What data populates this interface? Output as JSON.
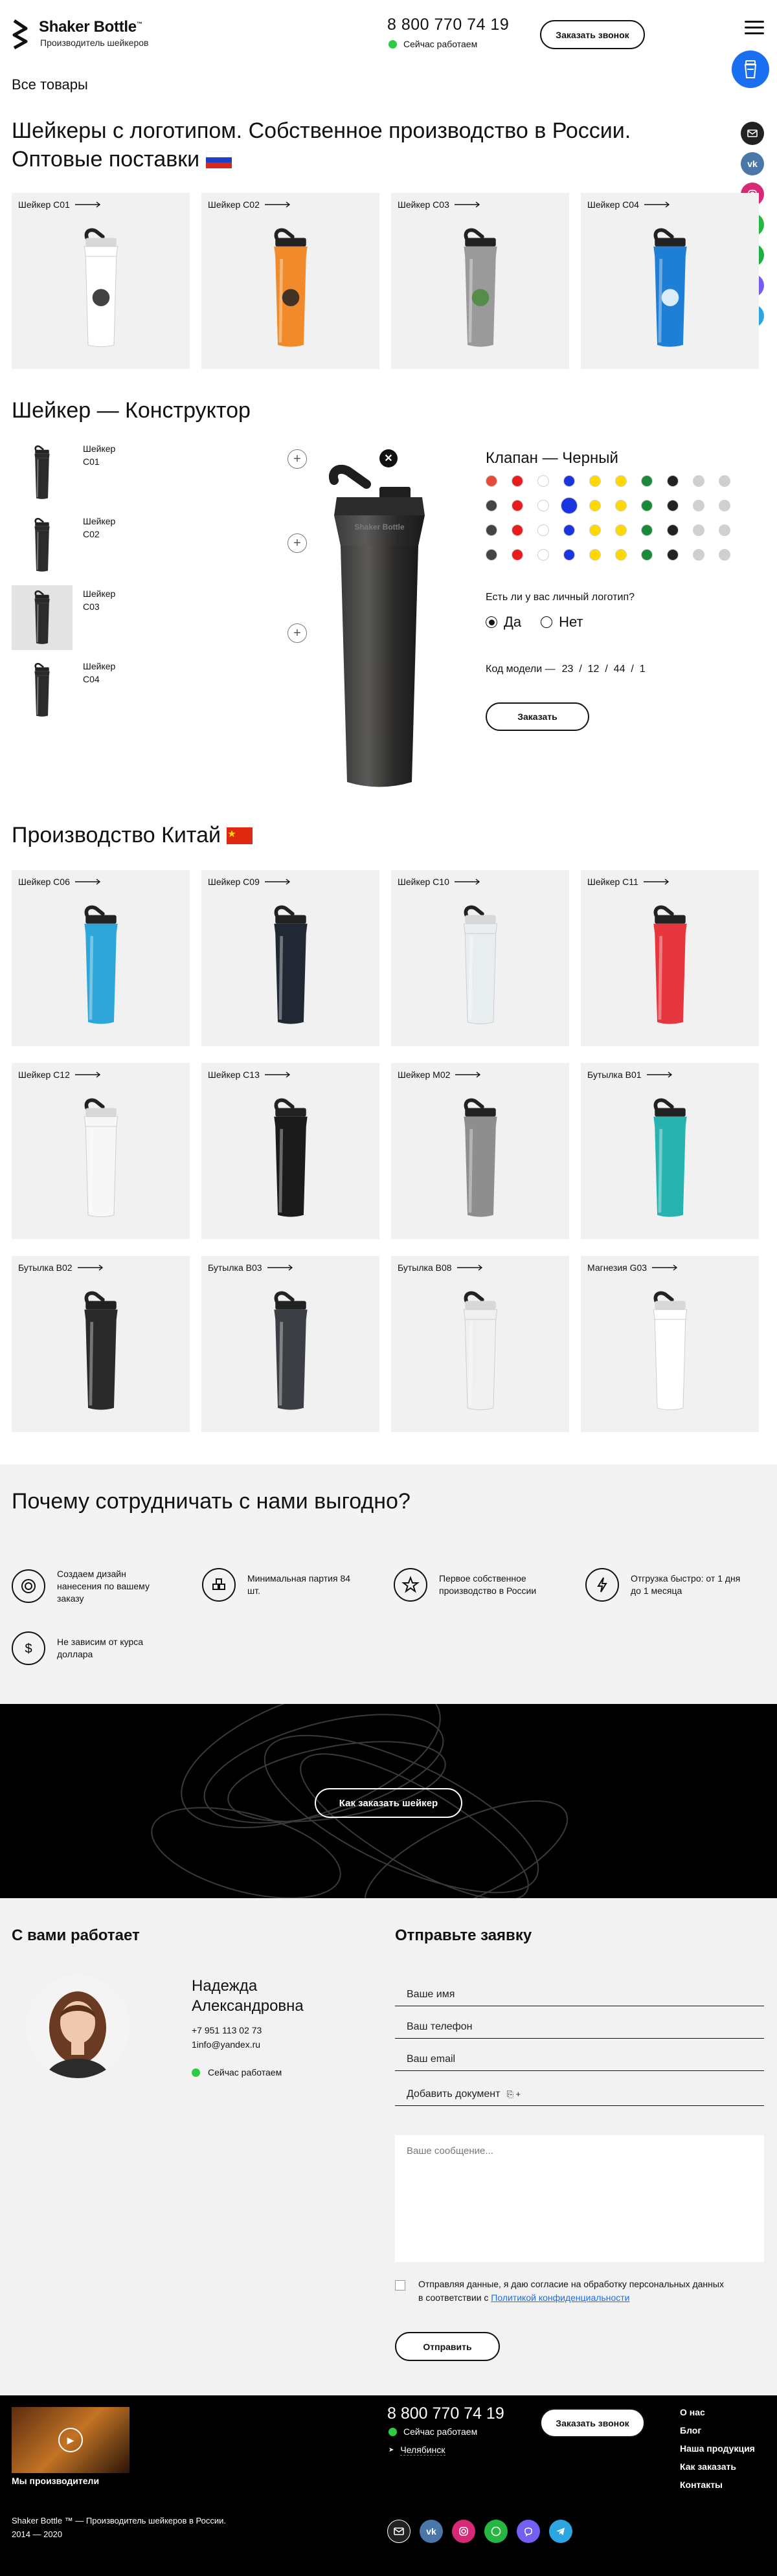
{
  "header": {
    "brand": "Shaker Bottle",
    "tm": "™",
    "subtitle": "Производитель шейкеров",
    "phone": "8 800 770 74 19",
    "status": "Сейчас работаем",
    "call_button": "Заказать звонок"
  },
  "breadcrumb": "Все товары",
  "section1": {
    "title": "Шейкеры с логотипом. Собственное производство в России. Оптовые поставки",
    "products": [
      {
        "label": "Шейкер C01",
        "color": "#ffffff",
        "accent": "#222222"
      },
      {
        "label": "Шейкер C02",
        "color": "#f08a2a",
        "accent": "#222222"
      },
      {
        "label": "Шейкер C03",
        "color": "#9a9a9a",
        "accent": "#4a8a3c"
      },
      {
        "label": "Шейкер C04",
        "color": "#1f7fd6",
        "accent": "#ffffff"
      }
    ]
  },
  "constructor": {
    "title": "Шейкер — Конструктор",
    "thumbs": [
      "Шейкер C01",
      "Шейкер C02",
      "Шейкер C03",
      "Шейкер C04"
    ],
    "valve_label": "Клапан — Черный",
    "swatch_rows": [
      [
        "#e84a3a",
        "#e81c1c",
        "#ffffff",
        "#1a35e0",
        "#ffd800",
        "#ffd800",
        "#1a8a3a",
        "#222222",
        "#d0d0d0",
        "#d0d0d0"
      ],
      [
        "#444444",
        "#e81c1c",
        "#ffffff",
        "#1a35e0",
        "#ffd800",
        "#ffd800",
        "#1a8a3a",
        "#222222",
        "#d0d0d0",
        "#d0d0d0"
      ],
      [
        "#444444",
        "#e81c1c",
        "#ffffff",
        "#1a35e0",
        "#ffd800",
        "#ffd800",
        "#1a8a3a",
        "#222222",
        "#d0d0d0",
        "#d0d0d0"
      ],
      [
        "#444444",
        "#e81c1c",
        "#ffffff",
        "#1a35e0",
        "#ffd800",
        "#ffd800",
        "#1a8a3a",
        "#222222",
        "#d0d0d0",
        "#d0d0d0"
      ]
    ],
    "logo_question": "Есть ли у вас личный логотип?",
    "yes": "Да",
    "no": "Нет",
    "model_label": "Код модели —",
    "model_code": "23  /  12  /  44  /  1",
    "order_button": "Заказать"
  },
  "section2": {
    "title": "Производство Китай",
    "products": [
      {
        "label": "Шейкер C06",
        "color": "#2fa6d9"
      },
      {
        "label": "Шейкер C09",
        "color": "#222833"
      },
      {
        "label": "Шейкер C10",
        "color": "#e8eef0"
      },
      {
        "label": "Шейкер C11",
        "color": "#e8363f"
      },
      {
        "label": "Шейкер C12",
        "color": "#f7f7f7"
      },
      {
        "label": "Шейкер C13",
        "color": "#1b1b1b"
      },
      {
        "label": "Шейкер M02",
        "color": "#8e8e8e"
      },
      {
        "label": "Бутылка B01",
        "color": "#28b3b0"
      },
      {
        "label": "Бутылка B02",
        "color": "#2a2a2a"
      },
      {
        "label": "Бутылка B03",
        "color": "#3b3f44"
      },
      {
        "label": "Бутылка B08",
        "color": "#f0f0f0"
      },
      {
        "label": "Магнезия G03",
        "color": "#ffffff"
      }
    ]
  },
  "why": {
    "title": "Почему сотрудничать с нами выгодно?",
    "items": [
      {
        "text": "Создаем дизайн нанесения по вашему заказу",
        "icon": "target-icon"
      },
      {
        "text": "Минимальная партия 84 шт.",
        "icon": "boxes-icon"
      },
      {
        "text": "Первое собственное производство в России",
        "icon": "star-icon"
      },
      {
        "text": "Отгрузка быстро: от 1 дня до 1 месяца",
        "icon": "lightning-icon"
      },
      {
        "text": "Не зависим от курса доллара",
        "icon": "dollar-icon"
      }
    ]
  },
  "how_button": "Как заказать шейкер",
  "manager": {
    "heading": "С вами работает",
    "name": "Надежда Александровна",
    "phone": "+7 951 113 02 73",
    "email": "1info@yandex.ru",
    "status": "Сейчас работаем"
  },
  "form": {
    "heading": "Отправьте заявку",
    "name_ph": "Ваше имя",
    "phone_ph": "Ваш телефон",
    "email_ph": "Ваш email",
    "attach": "Добавить документ",
    "message_ph": "Ваше сообщение...",
    "consent": "Отправляя данные, я даю согласие на обработку персональных данных в соответствии с",
    "policy": "Политикой конфиденциальности",
    "submit": "Отправить"
  },
  "footer": {
    "video_caption": "Мы производители",
    "phone": "8 800 770 74 19",
    "status": "Сейчас работаем",
    "city": "Челябинск",
    "call_button": "Заказать звонок",
    "menu": [
      "О нас",
      "Блог",
      "Наша продукция",
      "Как заказать",
      "Контакты"
    ],
    "copyright": "Shaker Bottle ™ — Производитель шейкеров в России.",
    "years": "2014 — 2020"
  }
}
